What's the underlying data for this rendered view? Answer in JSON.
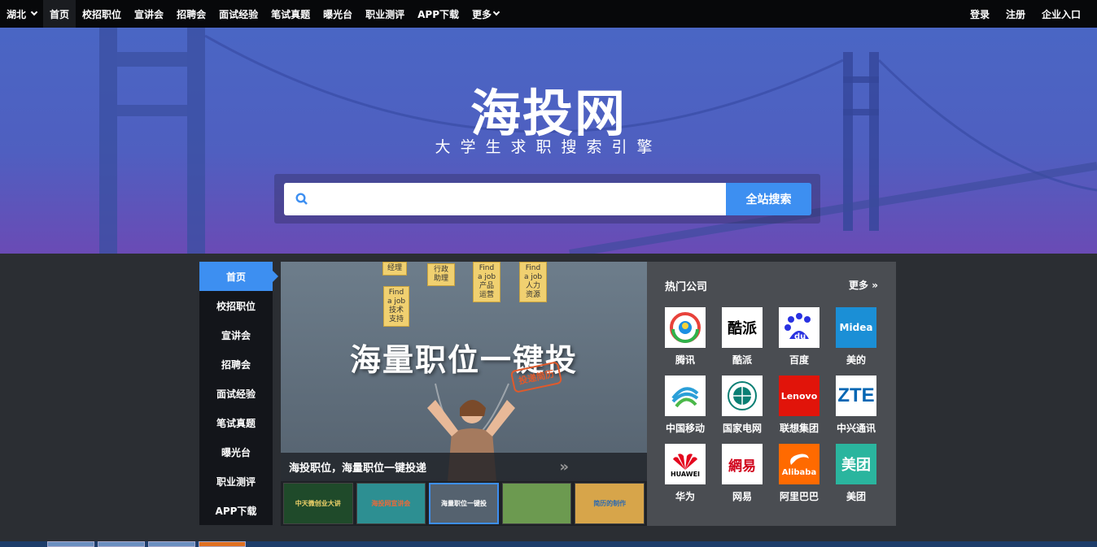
{
  "topnav": {
    "city": "湖北",
    "items": [
      "首页",
      "校招职位",
      "宣讲会",
      "招聘会",
      "面试经验",
      "笔试真题",
      "曝光台",
      "职业测评",
      "APP下载",
      "更多"
    ],
    "right": [
      "登录",
      "注册",
      "企业入口"
    ]
  },
  "hero": {
    "logo": "海投网",
    "slogan": "大学生求职搜索引擎",
    "search_placeholder": "",
    "search_button": "全站搜索"
  },
  "side_menu": [
    "首页",
    "校招职位",
    "宣讲会",
    "招聘会",
    "面试经验",
    "笔试真题",
    "曝光台",
    "职业测评",
    "APP下载"
  ],
  "banner": {
    "headline": "海量职位一键投",
    "stamp": "投递简历",
    "tags": [
      "经理",
      "行政助理",
      "Find a job 产品运营",
      "Find a job 人力资源",
      "Find a job 技术支持"
    ],
    "caption": "海投职位，海量职位一键投递"
  },
  "thumbs": [
    "中天微创业大讲",
    "海投网宣讲会",
    "海量职位一键投",
    "",
    "简历的制作"
  ],
  "companies": {
    "title": "热门公司",
    "more": "更多",
    "list": [
      {
        "name": "腾讯",
        "logo": "tencent"
      },
      {
        "name": "酷派",
        "logo": "酷派"
      },
      {
        "name": "百度",
        "logo": "du"
      },
      {
        "name": "美的",
        "logo": "Midea"
      },
      {
        "name": "中国移动",
        "logo": "china-mobile"
      },
      {
        "name": "国家电网",
        "logo": "sgcc"
      },
      {
        "name": "联想集团",
        "logo": "Lenovo"
      },
      {
        "name": "中兴通讯",
        "logo": "ZTE"
      },
      {
        "name": "华为",
        "logo": "HUAWEI"
      },
      {
        "name": "网易",
        "logo": "網易"
      },
      {
        "name": "阿里巴巴",
        "logo": "Alibaba"
      },
      {
        "name": "美团",
        "logo": "美团"
      }
    ]
  },
  "colors": {
    "accent": "#3d8ff1",
    "nav_bg": "#07080a",
    "panel_bg": "#4a4d52"
  }
}
